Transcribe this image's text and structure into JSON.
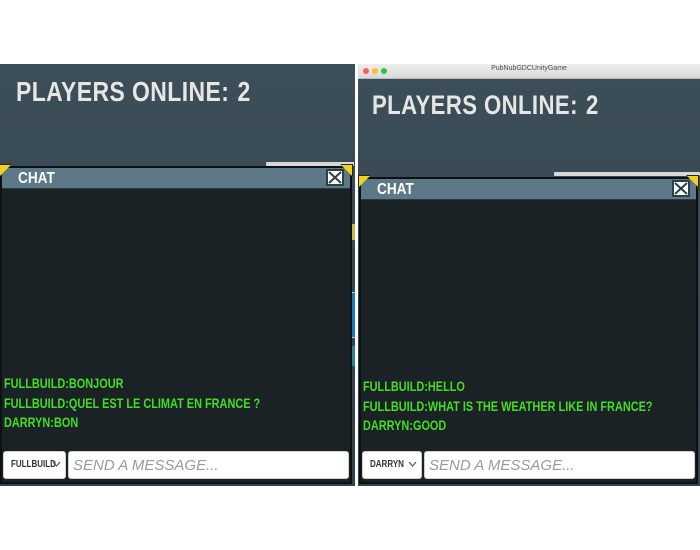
{
  "left": {
    "players_label": "PLAYERS ONLINE:",
    "players_count": "2",
    "chat_title": "CHAT",
    "messages": [
      "FULLBUILD:BONJOUR",
      "FULLBUILD:QUEL EST LE CLIMAT EN FRANCE ?",
      "DARRYN:BON"
    ],
    "user_select": "FULLBUILD",
    "input_placeholder": "SEND A MESSAGE..."
  },
  "right": {
    "window_title": "PubNubGDCUnityGame",
    "players_label": "PLAYERS ONLINE:",
    "players_count": "2",
    "chat_title": "CHAT",
    "messages": [
      "FULLBUILD:HELLO",
      "FULLBUILD:WHAT IS THE WEATHER LIKE IN FRANCE?",
      "DARRYN:GOOD"
    ],
    "user_select": "DARRYN",
    "input_placeholder": "SEND A MESSAGE..."
  },
  "colors": {
    "background": "#3c4e58",
    "chat_body": "#1b2226",
    "chat_header": "#5d7887",
    "message_text": "#44dd22",
    "corner_accent": "#f0d020"
  },
  "icons": {
    "close": "close-x-icon",
    "dropdown": "chevron-down-icon"
  }
}
